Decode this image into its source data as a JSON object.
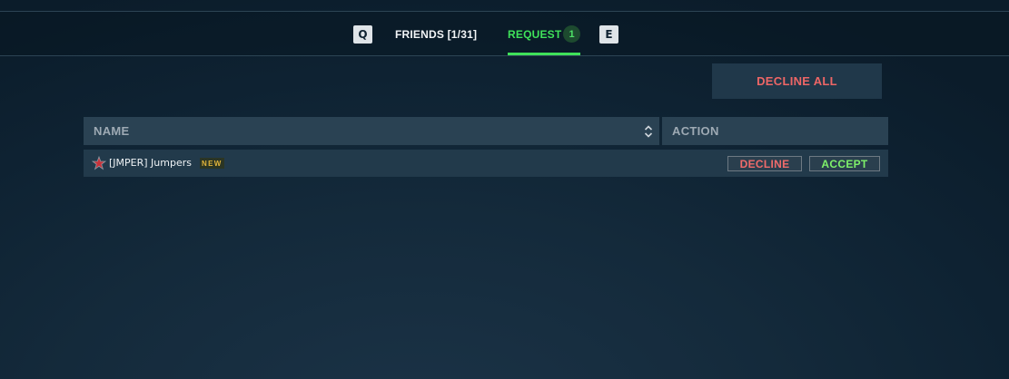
{
  "tabs": {
    "prev_key": "Q",
    "next_key": "E",
    "friends_label": "FRIENDS [1/31]",
    "request_label": "REQUEST",
    "request_count": "1",
    "active": "request"
  },
  "actions": {
    "decline_all_label": "DECLINE ALL"
  },
  "table": {
    "columns": {
      "name": "NAME",
      "action": "ACTION"
    },
    "rows": [
      {
        "flag_icon": "star-flag-icon",
        "name": "[JMPER] Jumpers",
        "badge": "NEW",
        "decline_label": "DECLINE",
        "accept_label": "ACCEPT"
      }
    ]
  },
  "colors": {
    "accent_green": "#3fe25a",
    "decline_red": "#ee6666",
    "badge_gold": "#e2b53b"
  }
}
